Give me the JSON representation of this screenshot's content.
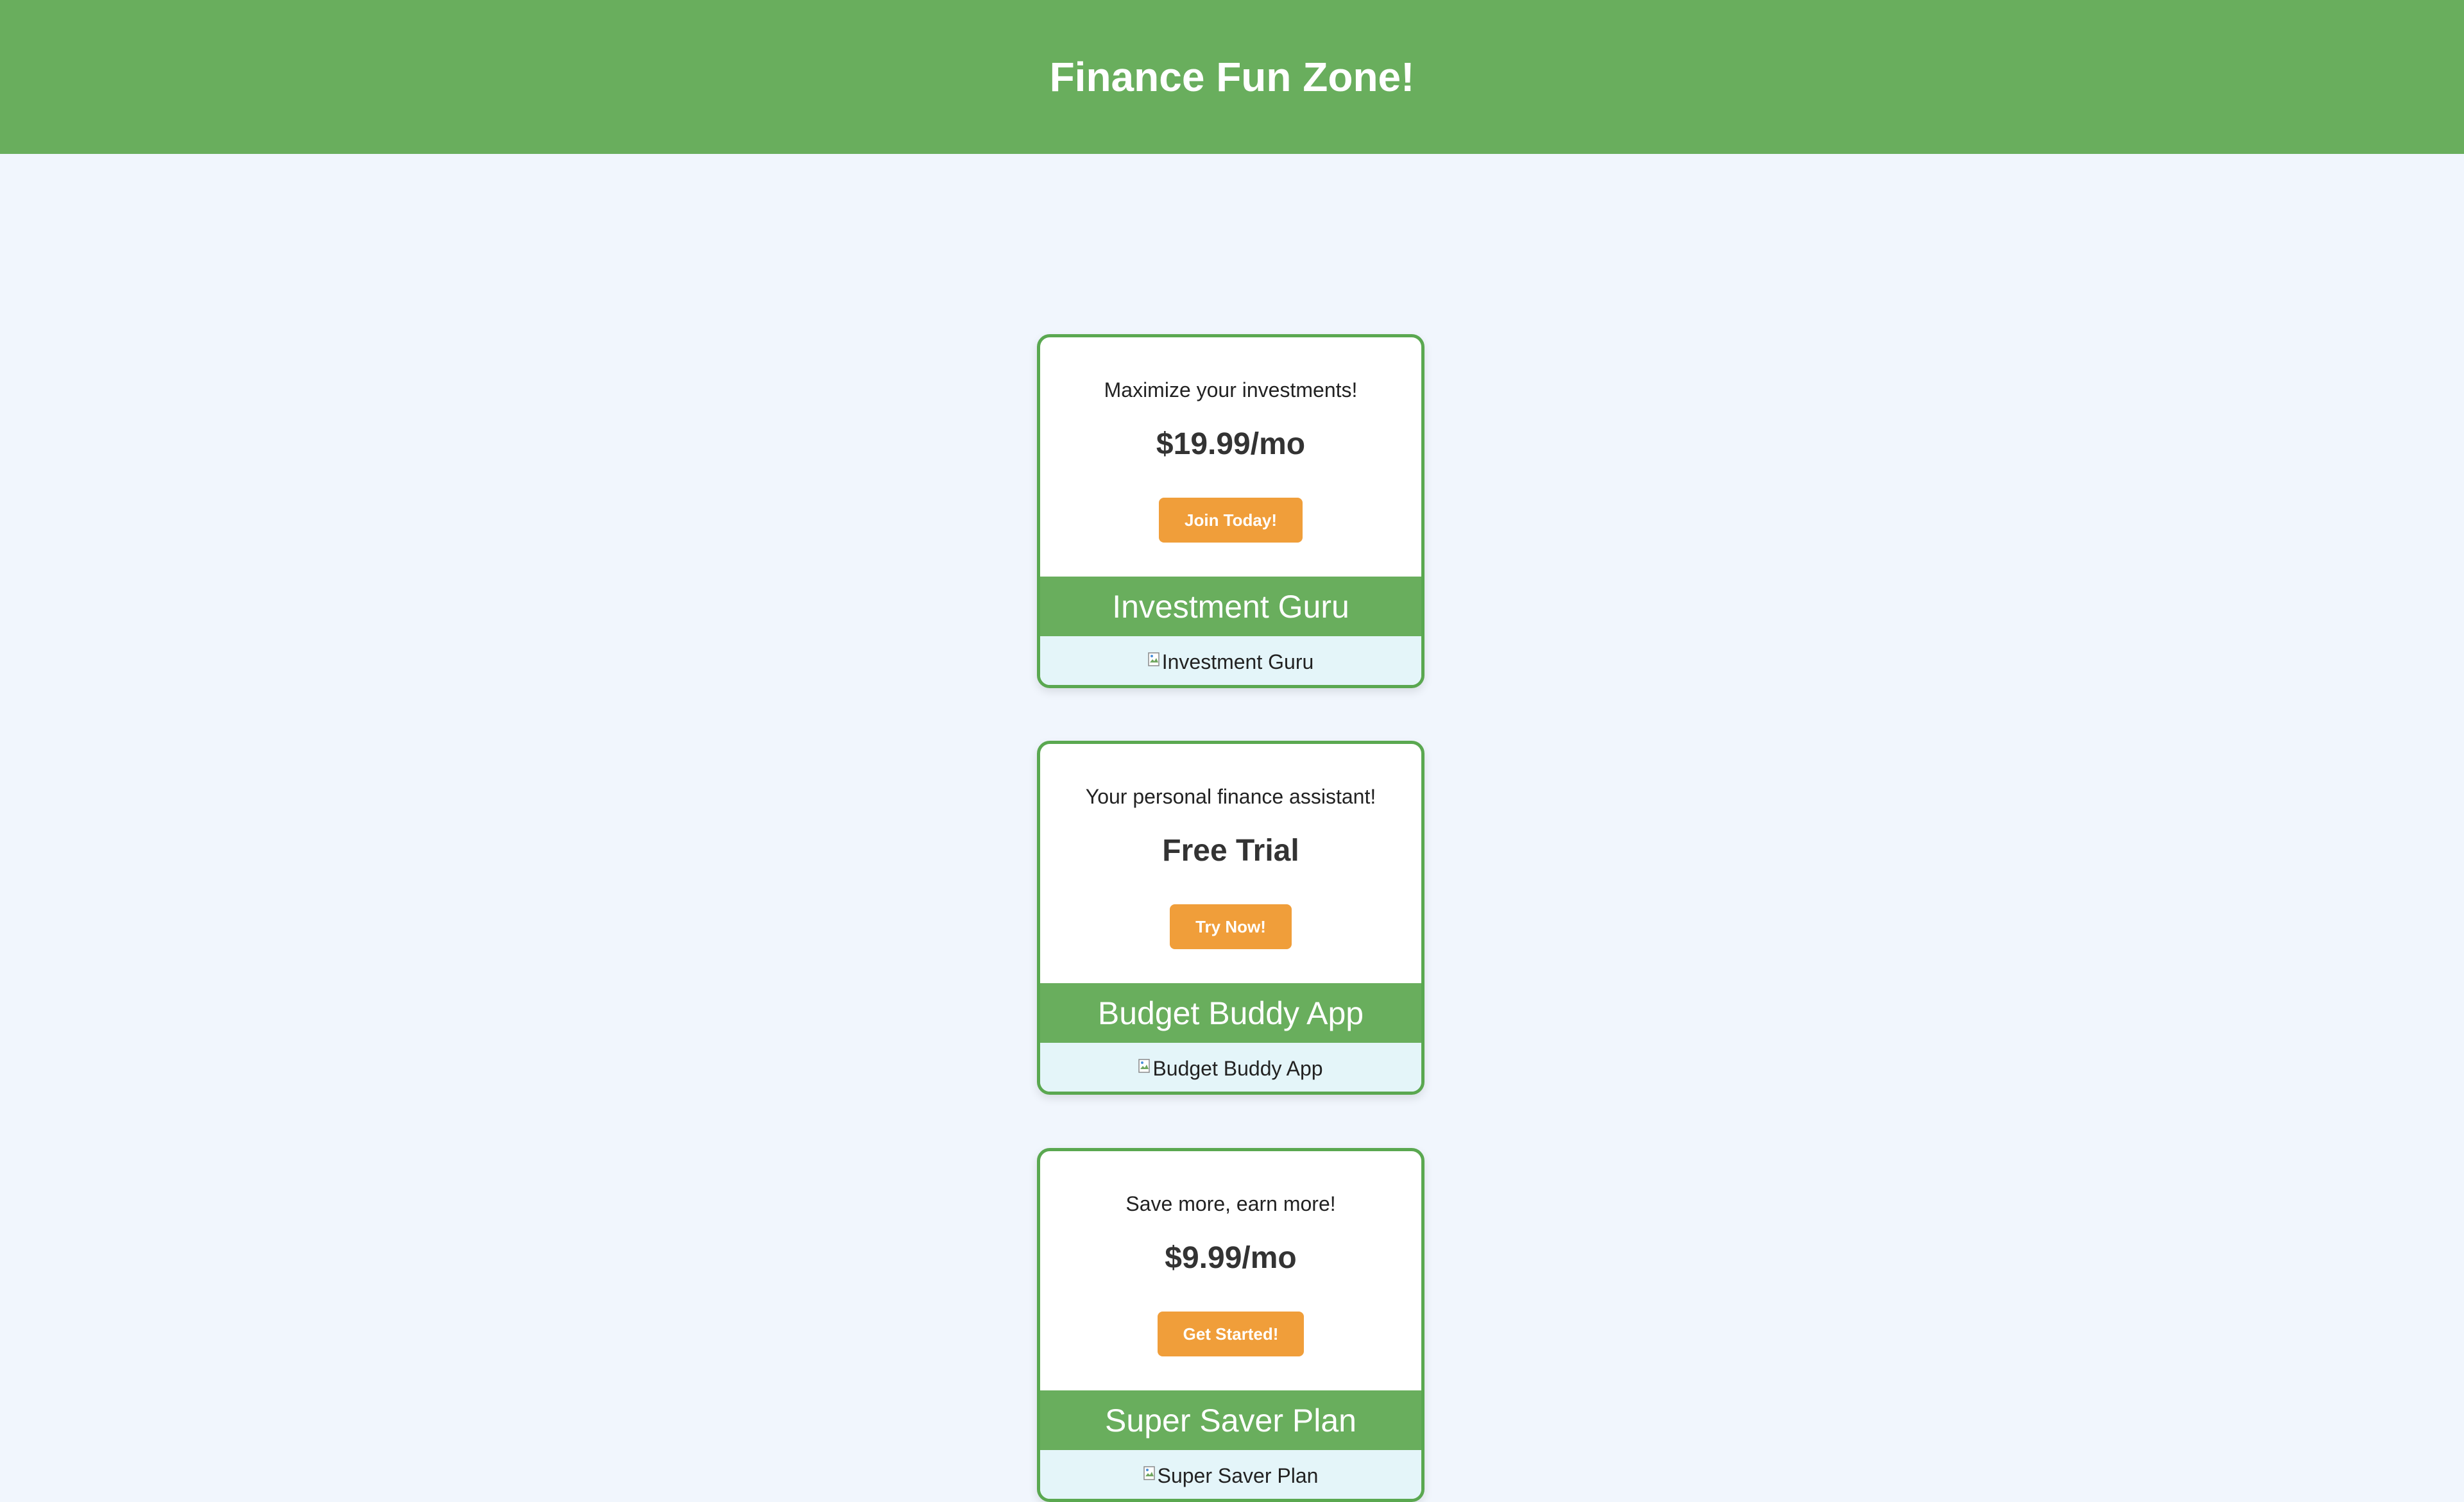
{
  "header": {
    "title": "Finance Fun Zone!",
    "background_color": "#69ae5d"
  },
  "colors": {
    "page_background": "#f1f6fd",
    "card_border": "#5aa850",
    "cta_button": "#f09e3a",
    "image_area": "#e4f5f9"
  },
  "cards": [
    {
      "tagline": "Maximize your investments!",
      "price": "$19.99/mo",
      "cta_label": "Join Today!",
      "name": "Investment Guru",
      "image_alt": "Investment Guru"
    },
    {
      "tagline": "Your personal finance assistant!",
      "price": "Free Trial",
      "cta_label": "Try Now!",
      "name": "Budget Buddy App",
      "image_alt": "Budget Buddy App"
    },
    {
      "tagline": "Save more, earn more!",
      "price": "$9.99/mo",
      "cta_label": "Get Started!",
      "name": "Super Saver Plan",
      "image_alt": "Super Saver Plan"
    }
  ]
}
